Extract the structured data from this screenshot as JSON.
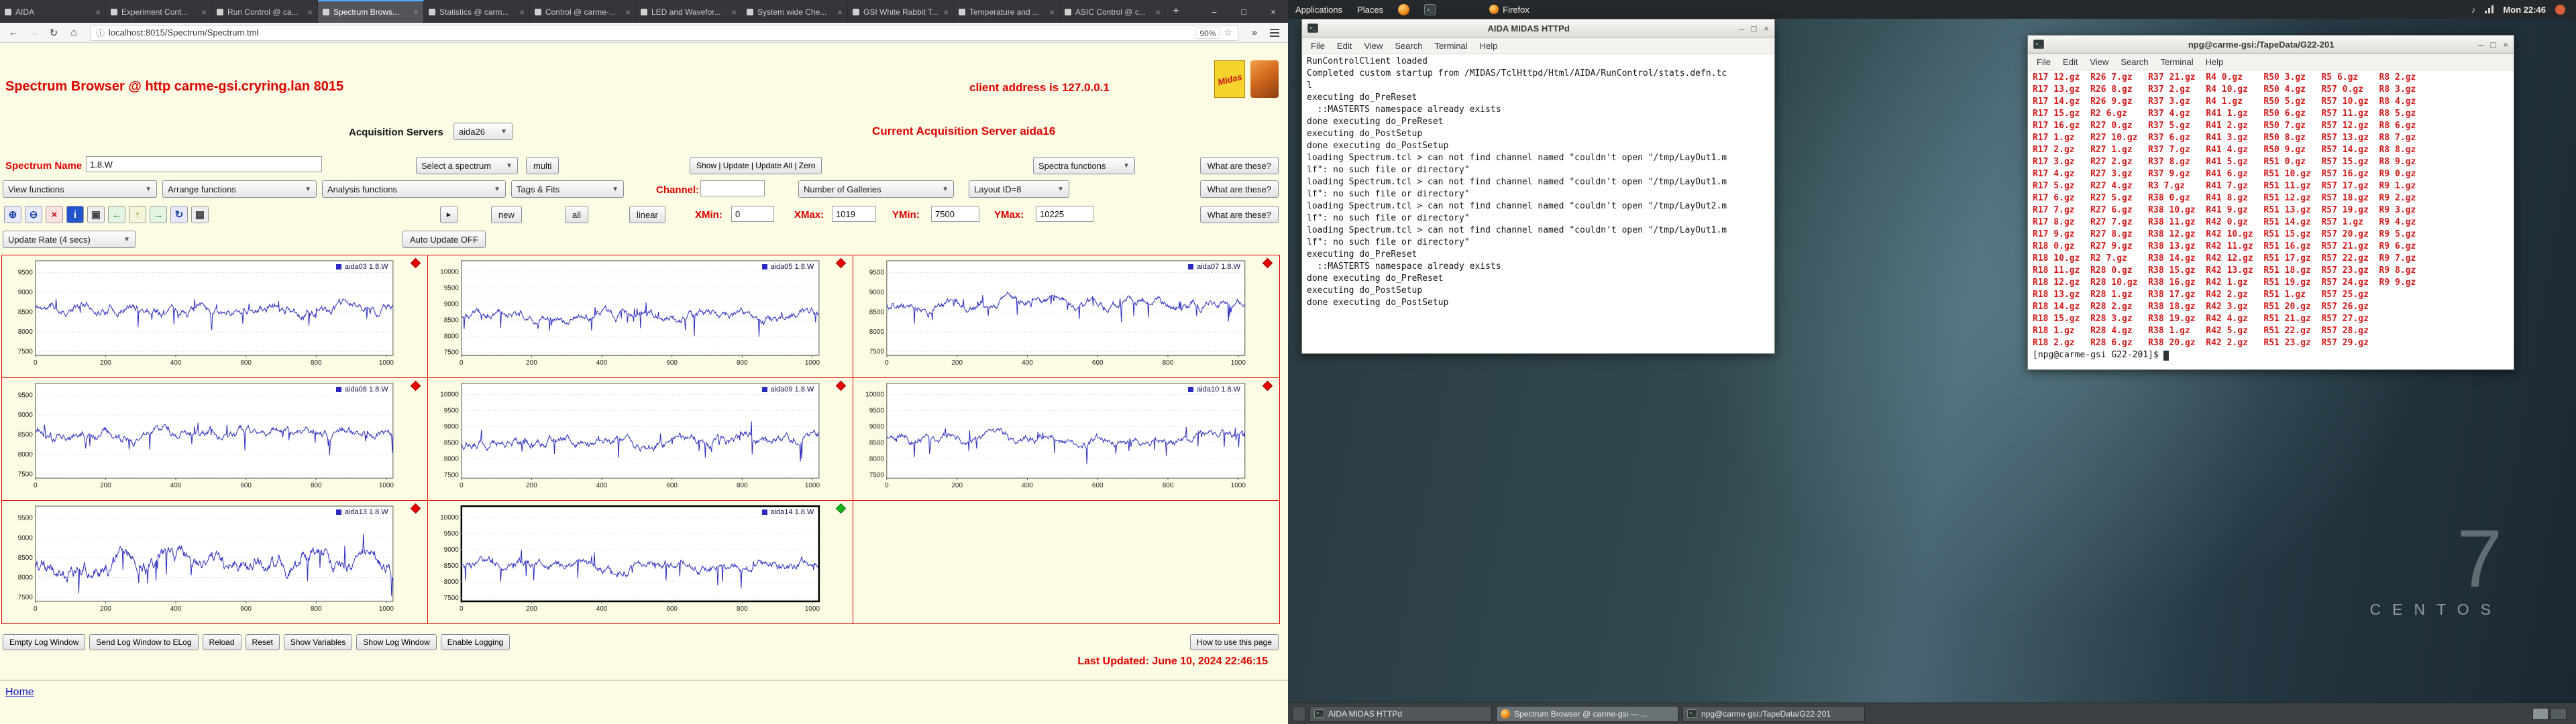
{
  "desktop": {
    "big7": "7",
    "label": "CENTOS"
  },
  "icons": {
    "terminal_glyph": ">_",
    "minimize": "–",
    "maximize": "□",
    "close": "×",
    "back": "←",
    "forward": "→",
    "reload": "↻",
    "home": "⌂",
    "info": "ⓘ",
    "star": "☆",
    "overflow": "»",
    "dropdown": "▼",
    "new_tab": "+"
  },
  "panel": {
    "applications": "Applications",
    "places": "Places",
    "app_name": "Firefox",
    "clock": "Mon 22:46"
  },
  "taskbar": {
    "items": [
      {
        "icon": "terminal-icon",
        "label": "AIDA MIDAS HTTPd",
        "active": false
      },
      {
        "icon": "firefox-icon",
        "label": "Spectrum Browser @ carme-gsi — ...",
        "active": true
      },
      {
        "icon": "terminal-icon",
        "label": "npg@carme-gsi:/TapeData/G22-201",
        "active": false
      }
    ]
  },
  "terminal_menu": [
    "File",
    "Edit",
    "View",
    "Search",
    "Terminal",
    "Help"
  ],
  "terminal1": {
    "title": "AIDA MIDAS HTTPd",
    "lines": [
      "RunControlClient loaded",
      "Completed custom startup from /MIDAS/TclHttpd/Html/AIDA/RunControl/stats.defn.tc",
      "l",
      "executing do_PreReset",
      "  ::MASTERTS namespace already exists",
      "done executing do_PreReset",
      "executing do_PostSetup",
      "done executing do_PostSetup",
      "loading Spectrum.tcl > can not find channel named \"couldn't open \"/tmp/LayOut1.m",
      "lf\": no such file or directory\"",
      "loading Spectrum.tcl > can not find channel named \"couldn't open \"/tmp/LayOut1.m",
      "lf\": no such file or directory\"",
      "loading Spectrum.tcl > can not find channel named \"couldn't open \"/tmp/LayOut2.m",
      "lf\": no such file or directory\"",
      "loading Spectrum.tcl > can not find channel named \"couldn't open \"/tmp/LayOut1.m",
      "lf\": no such file or directory\"",
      "executing do_PreReset",
      "  ::MASTERTS namespace already exists",
      "done executing do_PreReset",
      "executing do_PostSetup",
      "done executing do_PostSetup"
    ]
  },
  "terminal2": {
    "title": "npg@carme-gsi:/TapeData/G22-201",
    "rows": [
      [
        "R17 12.gz",
        "R26 7.gz",
        "R37 21.gz",
        "R4 0.gz",
        "R50 3.gz",
        "R5 6.gz",
        "R8 2.gz"
      ],
      [
        "R17 13.gz",
        "R26 8.gz",
        "R37 2.gz",
        "R4 10.gz",
        "R50 4.gz",
        "R57 0.gz",
        "R8 3.gz"
      ],
      [
        "R17 14.gz",
        "R26 9.gz",
        "R37 3.gz",
        "R4 1.gz",
        "R50 5.gz",
        "R57 10.gz",
        "R8 4.gz"
      ],
      [
        "R17 15.gz",
        "R2 6.gz",
        "R37 4.gz",
        "R41 1.gz",
        "R50 6.gz",
        "R57 11.gz",
        "R8 5.gz"
      ],
      [
        "R17 16.gz",
        "R27 0.gz",
        "R37 5.gz",
        "R41 2.gz",
        "R50 7.gz",
        "R57 12.gz",
        "R8 6.gz"
      ],
      [
        "R17 1.gz",
        "R27 10.gz",
        "R37 6.gz",
        "R41 3.gz",
        "R50 8.gz",
        "R57 13.gz",
        "R8 7.gz"
      ],
      [
        "R17 2.gz",
        "R27 1.gz",
        "R37 7.gz",
        "R41 4.gz",
        "R50 9.gz",
        "R57 14.gz",
        "R8 8.gz"
      ],
      [
        "R17 3.gz",
        "R27 2.gz",
        "R37 8.gz",
        "R41 5.gz",
        "R51 0.gz",
        "R57 15.gz",
        "R8 9.gz"
      ],
      [
        "R17 4.gz",
        "R27 3.gz",
        "R37 9.gz",
        "R41 6.gz",
        "R51 10.gz",
        "R57 16.gz",
        "R9 0.gz"
      ],
      [
        "R17 5.gz",
        "R27 4.gz",
        "R3 7.gz",
        "R41 7.gz",
        "R51 11.gz",
        "R57 17.gz",
        "R9 1.gz"
      ],
      [
        "R17 6.gz",
        "R27 5.gz",
        "R38 0.gz",
        "R41 8.gz",
        "R51 12.gz",
        "R57 18.gz",
        "R9 2.gz"
      ],
      [
        "R17 7.gz",
        "R27 6.gz",
        "R38 10.gz",
        "R41 9.gz",
        "R51 13.gz",
        "R57 19.gz",
        "R9 3.gz"
      ],
      [
        "R17 8.gz",
        "R27 7.gz",
        "R38 11.gz",
        "R42 0.gz",
        "R51 14.gz",
        "R57 1.gz",
        "R9 4.gz"
      ],
      [
        "R17 9.gz",
        "R27 8.gz",
        "R38 12.gz",
        "R42 10.gz",
        "R51 15.gz",
        "R57 20.gz",
        "R9 5.gz"
      ],
      [
        "R18 0.gz",
        "R27 9.gz",
        "R38 13.gz",
        "R42 11.gz",
        "R51 16.gz",
        "R57 21.gz",
        "R9 6.gz"
      ],
      [
        "R18 10.gz",
        "R2 7.gz",
        "R38 14.gz",
        "R42 12.gz",
        "R51 17.gz",
        "R57 22.gz",
        "R9 7.gz"
      ],
      [
        "R18 11.gz",
        "R28 0.gz",
        "R38 15.gz",
        "R42 13.gz",
        "R51 18.gz",
        "R57 23.gz",
        "R9 8.gz"
      ],
      [
        "R18 12.gz",
        "R28 10.gz",
        "R38 16.gz",
        "R42 1.gz",
        "R51 19.gz",
        "R57 24.gz",
        "R9 9.gz"
      ],
      [
        "R18 13.gz",
        "R28 1.gz",
        "R38 17.gz",
        "R42 2.gz",
        "R51 1.gz",
        "R57 25.gz"
      ],
      [
        "R18 14.gz",
        "R28 2.gz",
        "R38 18.gz",
        "R42 3.gz",
        "R51 20.gz",
        "R57 26.gz"
      ],
      [
        "R18 15.gz",
        "R28 3.gz",
        "R38 19.gz",
        "R42 4.gz",
        "R51 21.gz",
        "R57 27.gz"
      ],
      [
        "R18 1.gz",
        "R28 4.gz",
        "R38 1.gz",
        "R42 5.gz",
        "R51 22.gz",
        "R57 28.gz"
      ],
      [
        "R18 2.gz",
        "R28 6.gz",
        "R38 20.gz",
        "R42 2.gz",
        "R51 23.gz",
        "R57 29.gz"
      ]
    ],
    "prompt": "[npg@carme-gsi G22-201]$"
  },
  "browser": {
    "tabs": [
      {
        "label": "AIDA",
        "active": false
      },
      {
        "label": "Experiment Cont...",
        "active": false
      },
      {
        "label": "Run Control @ ca...",
        "active": false
      },
      {
        "label": "Spectrum Brows...",
        "active": true
      },
      {
        "label": "Statistics @ carm...",
        "active": false
      },
      {
        "label": "Control @ carme-...",
        "active": false
      },
      {
        "label": "LED and Wavefor...",
        "active": false
      },
      {
        "label": "System wide Che...",
        "active": false
      },
      {
        "label": "GSI White Rabbit T...",
        "active": false
      },
      {
        "label": "Temperature and ...",
        "active": false
      },
      {
        "label": "ASIC Control @ c...",
        "active": false
      }
    ],
    "nav": {
      "url": "localhost:8015/Spectrum/Spectrum.tml",
      "zoom": "90%"
    },
    "page": {
      "title": "Spectrum Browser @ http carme-gsi.cryring.lan 8015",
      "client": "client address is 127.0.0.1",
      "midas_logo": "Midas",
      "acquisition_label": "Acquisition Servers",
      "acquisition_server": "aida26",
      "current_server": "Current Acquisition Server aida16",
      "spectrum_name_label": "Spectrum Name",
      "spectrum_name_value": "1.8.W",
      "select_spectrum": "Select a spectrum",
      "multi_button": "multi",
      "action_group": "Show | Update | Update All | Zero",
      "spectra_functions": "Spectra functions",
      "what_are_these": "What are these?",
      "view_functions": "View functions",
      "arrange_functions": "Arrange functions",
      "analysis_functions": "Analysis functions",
      "tags_fits": "Tags & Fits",
      "channel_label": "Channel:",
      "channel_value": "",
      "galleries": "Number of Galleries",
      "layout": "Layout ID=8",
      "gallery_toggle": "▸",
      "new_button": "new",
      "all_button": "all",
      "linear_button": "linear",
      "xmin_label": "XMin:",
      "xmin_value": "0",
      "xmax_label": "XMax:",
      "xmax_value": "1019",
      "ymin_label": "YMin:",
      "ymin_value": "7500",
      "ymax_label": "YMax:",
      "ymax_value": "10225",
      "update_rate": "Update Rate (4 secs)",
      "auto_update": "Auto Update OFF",
      "tool_icons": [
        {
          "name": "zoom-in-icon",
          "glyph": "⊕",
          "bg": "#e8e8ff",
          "fg": "#1540a0"
        },
        {
          "name": "zoom-out-icon",
          "glyph": "⊖",
          "bg": "#e8e8ff",
          "fg": "#1540a0"
        },
        {
          "name": "unzoom-icon",
          "glyph": "×",
          "bg": "#ffe2e2",
          "fg": "#c01010"
        },
        {
          "name": "info-icon",
          "glyph": "i",
          "bg": "#2255cc",
          "fg": "#ffffff"
        },
        {
          "name": "overlay-icon",
          "glyph": "▣",
          "bg": "#eeeeee",
          "fg": "#444444"
        },
        {
          "name": "arrow-left-icon",
          "glyph": "←",
          "bg": "#e2f5e2",
          "fg": "#118811"
        },
        {
          "name": "arrow-up-icon",
          "glyph": "↑",
          "bg": "#f4f4d8",
          "fg": "#888811"
        },
        {
          "name": "arrow-right-icon",
          "glyph": "→",
          "bg": "#e2f5e2",
          "fg": "#118811"
        },
        {
          "name": "refresh-icon",
          "glyph": "↻",
          "bg": "#e8e8ff",
          "fg": "#1540a0"
        },
        {
          "name": "grid-icon",
          "glyph": "▦",
          "bg": "#eeeeee",
          "fg": "#444444"
        }
      ],
      "footer_buttons": [
        "Empty Log Window",
        "Send Log Window to ELog",
        "Reload",
        "Reset",
        "Show Variables",
        "Show Log Window",
        "Enable Logging"
      ],
      "help_button": "How to use this page",
      "last_updated": "Last Updated: June 10, 2024 22:46:15",
      "home_link": "Home"
    }
  },
  "chart_data": {
    "type": "line",
    "series_label": "1.8.W",
    "x_range": [
      0,
      1019
    ],
    "xticks": [
      0,
      200,
      400,
      600,
      800,
      1000
    ],
    "trace_color": "#2a2abf",
    "panels": [
      {
        "name": "aida03",
        "label": "aida03 1.8.W",
        "diamond": "#e60000",
        "yticks": [
          7500,
          8000,
          8500,
          9000,
          9500
        ],
        "ymax_plot": 9800,
        "baseline": 8600,
        "noise": 150,
        "spike_amp": 450,
        "seed": 11,
        "selected": false
      },
      {
        "name": "aida05",
        "label": "aida05 1.8.W",
        "diamond": "#e60000",
        "yticks": [
          7500,
          8000,
          8500,
          9000,
          9500,
          10000
        ],
        "ymax_plot": 10350,
        "baseline": 8650,
        "noise": 170,
        "spike_amp": 600,
        "seed": 23,
        "selected": false
      },
      {
        "name": "aida07",
        "label": "aida07 1.8.W",
        "diamond": "#e60000",
        "yticks": [
          7500,
          8000,
          8500,
          9000,
          9500
        ],
        "ymax_plot": 9800,
        "baseline": 8700,
        "noise": 140,
        "spike_amp": 420,
        "seed": 37,
        "selected": false
      },
      {
        "name": "aida08",
        "label": "aida08 1.8.W",
        "diamond": "#e60000",
        "yticks": [
          7500,
          8000,
          8500,
          9000,
          9500
        ],
        "ymax_plot": 9800,
        "baseline": 8500,
        "noise": 150,
        "spike_amp": 480,
        "seed": 41,
        "selected": false
      },
      {
        "name": "aida09",
        "label": "aida09 1.8.W",
        "diamond": "#e60000",
        "yticks": [
          7500,
          8000,
          8500,
          9000,
          9500,
          10000
        ],
        "ymax_plot": 10350,
        "baseline": 8550,
        "noise": 180,
        "spike_amp": 650,
        "seed": 53,
        "selected": false
      },
      {
        "name": "aida10",
        "label": "aida10 1.8.W",
        "diamond": "#e60000",
        "yticks": [
          7500,
          8000,
          8500,
          9000,
          9500,
          10000
        ],
        "ymax_plot": 10350,
        "baseline": 8600,
        "noise": 160,
        "spike_amp": 520,
        "seed": 67,
        "selected": false
      },
      {
        "name": "aida13",
        "label": "aida13 1.8.W",
        "diamond": "#e60000",
        "yticks": [
          7500,
          8000,
          8500,
          9000,
          9500
        ],
        "ymax_plot": 9800,
        "baseline": 8350,
        "noise": 260,
        "spike_amp": 600,
        "seed": 79,
        "selected": false
      },
      {
        "name": "aida14",
        "label": "aida14 1.8.W",
        "diamond": "#19b219",
        "yticks": [
          7500,
          8000,
          8500,
          9000,
          9500,
          10000
        ],
        "ymax_plot": 10350,
        "baseline": 8500,
        "noise": 170,
        "spike_amp": 560,
        "seed": 97,
        "selected": true
      }
    ]
  }
}
